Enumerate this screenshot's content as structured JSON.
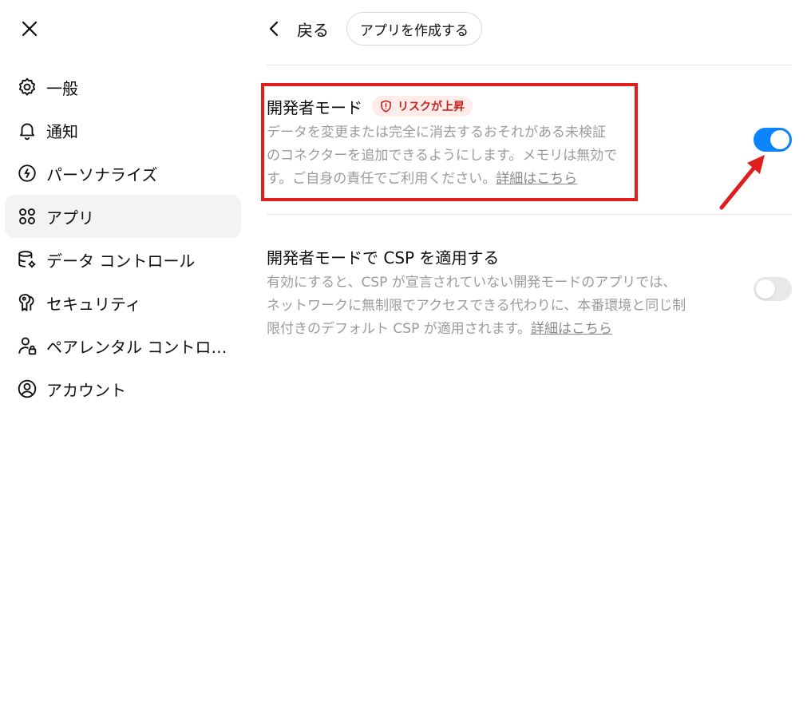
{
  "sidebar": {
    "close_icon": "close-icon",
    "items": [
      {
        "label": "一般",
        "icon": "gear-icon",
        "active": false
      },
      {
        "label": "通知",
        "icon": "bell-icon",
        "active": false
      },
      {
        "label": "パーソナライズ",
        "icon": "personalize-icon",
        "active": false
      },
      {
        "label": "アプリ",
        "icon": "apps-grid-icon",
        "active": true
      },
      {
        "label": "データ コントロール",
        "icon": "database-gear-icon",
        "active": false
      },
      {
        "label": "セキュリティ",
        "icon": "key-icon",
        "active": false
      },
      {
        "label": "ペアレンタル コントロール",
        "icon": "parent-lock-icon",
        "active": false
      },
      {
        "label": "アカウント",
        "icon": "user-circle-icon",
        "active": false
      }
    ]
  },
  "topbar": {
    "back_label": "戻る",
    "create_app_label": "アプリを作成する"
  },
  "settings": [
    {
      "title": "開発者モード",
      "badge": "リスクが上昇",
      "description": "データを変更または完全に消去するおそれがある未検証のコネクターを追加できるようにします。メモリは無効です。ご自身の責任でご利用ください。",
      "link": "詳細はこちら",
      "enabled": true
    },
    {
      "title": "開発者モードで CSP を適用する",
      "description": "有効にすると、CSP が宣言されていない開発モードのアプリでは、ネットワークに無制限でアクセスできる代わりに、本番環境と同じ制限付きのデフォルト CSP が適用されます。",
      "link": "詳細はこちら",
      "enabled": false
    }
  ],
  "colors": {
    "toggle_on": "#0a84ff",
    "toggle_off": "#e8e8e8",
    "badge_text": "#c8231c",
    "badge_bg": "#fdecea",
    "annotation": "#e01e1e"
  }
}
